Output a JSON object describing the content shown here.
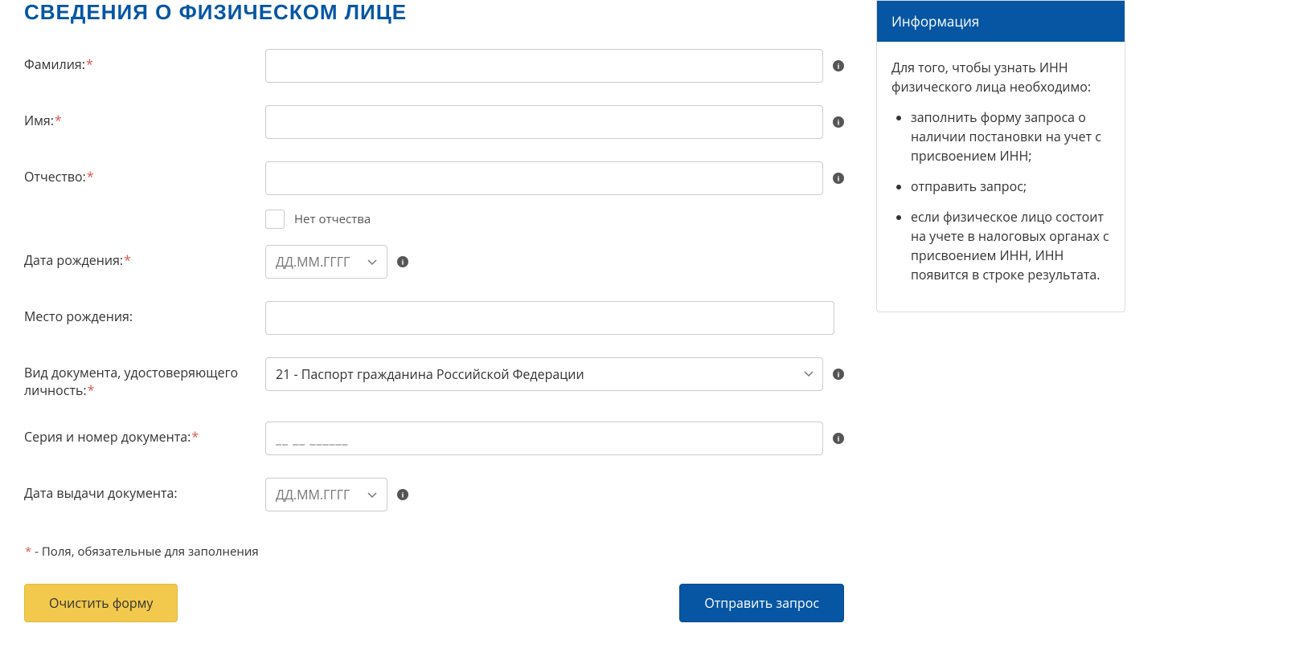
{
  "page": {
    "title": "СВЕДЕНИЯ О ФИЗИЧЕСКОМ ЛИЦЕ"
  },
  "form": {
    "surname": {
      "label": "Фамилия:",
      "value": ""
    },
    "name": {
      "label": "Имя:",
      "value": ""
    },
    "patronymic": {
      "label": "Отчество:",
      "value": ""
    },
    "no_patronymic_label": "Нет отчества",
    "birth_date": {
      "label": "Дата рождения:",
      "placeholder": "ДД.ММ.ГГГГ"
    },
    "birth_place": {
      "label": "Место рождения:",
      "value": ""
    },
    "doc_type": {
      "label": "Вид документа, удостоверяющего личность:",
      "selected": "21 - Паспорт гражданина Российской Федерации"
    },
    "doc_number": {
      "label": "Серия и номер документа:",
      "placeholder": "__ __ ______"
    },
    "doc_date": {
      "label": "Дата выдачи документа:",
      "placeholder": "ДД.ММ.ГГГГ"
    },
    "required_note_star": "*",
    "required_note_text": " - Поля, обязательные для заполнения",
    "clear_button": "Очистить форму",
    "submit_button": "Отправить запрос"
  },
  "sidebar": {
    "header": "Информация",
    "intro": "Для того, чтобы узнать ИНН физического лица необходимо:",
    "items": [
      "заполнить форму запроса о наличии постановки на учет с присвоением ИНН;",
      "отправить запрос;",
      "если физическое лицо состоит на учете в налоговых органах с присвоением ИНН, ИНН появится в строке результата."
    ]
  }
}
